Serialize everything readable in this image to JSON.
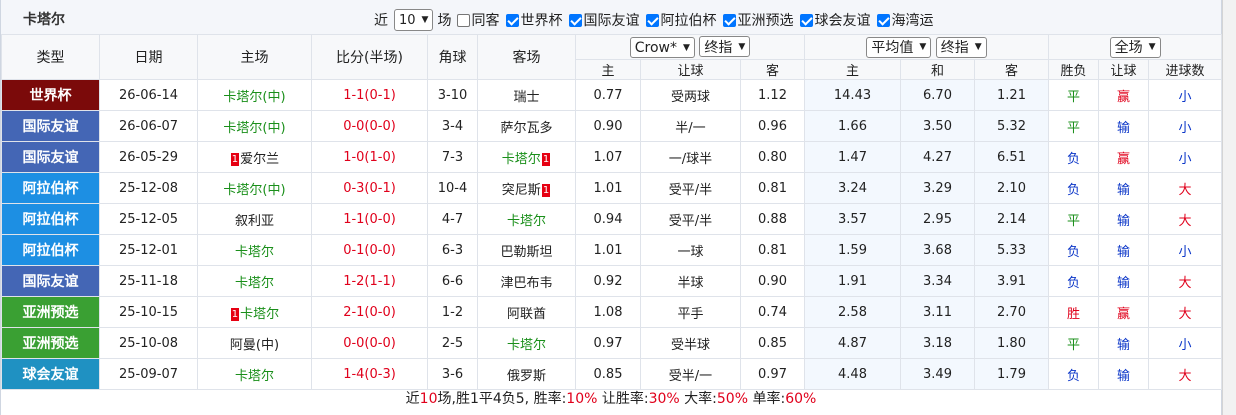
{
  "header": {
    "team": "卡塔尔",
    "near_label": "近",
    "count_value": "10",
    "games_label": "场",
    "filters": [
      {
        "label": "同客",
        "checked": false
      },
      {
        "label": "世界杯",
        "checked": true
      },
      {
        "label": "国际友谊",
        "checked": true
      },
      {
        "label": "阿拉伯杯",
        "checked": true
      },
      {
        "label": "亚洲预选",
        "checked": true
      },
      {
        "label": "球会友谊",
        "checked": true
      },
      {
        "label": "海湾运",
        "checked": true
      }
    ]
  },
  "columns": {
    "type": "类型",
    "date": "日期",
    "home": "主场",
    "score": "比分(半场)",
    "corner": "角球",
    "away": "客场",
    "company_select": "Crow*",
    "handicap_select": "终指",
    "odds_select": "平均值",
    "odds_select2": "终指",
    "result_select": "全场",
    "sub": {
      "h1": "主",
      "hcap": "让球",
      "a1": "客",
      "h2": "主",
      "draw": "和",
      "a2": "客",
      "wl": "胜负",
      "hcap_result": "让球",
      "goals": "进球数"
    }
  },
  "colors": {
    "世界杯": "#7b0a0a",
    "国际友谊": "#4466b5",
    "阿拉伯杯": "#1d8fe3",
    "亚洲预选": "#3aa033",
    "球会友谊": "#1f91c2",
    "win": "#e0001b",
    "draw": "#1a8f1a",
    "lose": "#0a35c8"
  },
  "rows": [
    {
      "league": "世界杯",
      "date": "26-06-14",
      "home": "卡塔尔(中)",
      "home_card": "",
      "home_card_after": "",
      "score": "1-1",
      "half": "(0-1)",
      "corner": "3-10",
      "away": "瑞士",
      "away_card": "",
      "o1": "0.77",
      "hcap": "受两球",
      "o2": "1.12",
      "avg_h": "14.43",
      "avg_d": "6.70",
      "avg_a": "1.21",
      "wl": "平",
      "hr": "赢",
      "goals": "小"
    },
    {
      "league": "国际友谊",
      "date": "26-06-07",
      "home": "卡塔尔(中)",
      "home_card": "",
      "home_card_after": "",
      "score": "0-0",
      "half": "(0-0)",
      "corner": "3-4",
      "away": "萨尔瓦多",
      "away_card": "",
      "o1": "0.90",
      "hcap": "半/一",
      "o2": "0.96",
      "avg_h": "1.66",
      "avg_d": "3.50",
      "avg_a": "5.32",
      "wl": "平",
      "hr": "输",
      "goals": "小"
    },
    {
      "league": "国际友谊",
      "date": "26-05-29",
      "home": "爱尔兰",
      "home_card": "1",
      "home_card_after": "",
      "score": "1-0",
      "half": "(1-0)",
      "corner": "7-3",
      "away": "卡塔尔",
      "away_card": "1",
      "o1": "1.07",
      "hcap": "一/球半",
      "o2": "0.80",
      "avg_h": "1.47",
      "avg_d": "4.27",
      "avg_a": "6.51",
      "wl": "负",
      "hr": "赢",
      "goals": "小"
    },
    {
      "league": "阿拉伯杯",
      "date": "25-12-08",
      "home": "卡塔尔(中)",
      "home_card": "",
      "home_card_after": "",
      "score": "0-3",
      "half": "(0-1)",
      "corner": "10-4",
      "away": "突尼斯",
      "away_card": "1",
      "o1": "1.01",
      "hcap": "受平/半",
      "o2": "0.81",
      "avg_h": "3.24",
      "avg_d": "3.29",
      "avg_a": "2.10",
      "wl": "负",
      "hr": "输",
      "goals": "大"
    },
    {
      "league": "阿拉伯杯",
      "date": "25-12-05",
      "home": "叙利亚",
      "home_card": "",
      "home_card_after": "",
      "score": "1-1",
      "half": "(0-0)",
      "corner": "4-7",
      "away": "卡塔尔",
      "away_card": "",
      "o1": "0.94",
      "hcap": "受平/半",
      "o2": "0.88",
      "avg_h": "3.57",
      "avg_d": "2.95",
      "avg_a": "2.14",
      "wl": "平",
      "hr": "输",
      "goals": "大"
    },
    {
      "league": "阿拉伯杯",
      "date": "25-12-01",
      "home": "卡塔尔",
      "home_card": "",
      "home_card_after": "",
      "score": "0-1",
      "half": "(0-0)",
      "corner": "6-3",
      "away": "巴勒斯坦",
      "away_card": "",
      "o1": "1.01",
      "hcap": "一球",
      "o2": "0.81",
      "avg_h": "1.59",
      "avg_d": "3.68",
      "avg_a": "5.33",
      "wl": "负",
      "hr": "输",
      "goals": "小"
    },
    {
      "league": "国际友谊",
      "date": "25-11-18",
      "home": "卡塔尔",
      "home_card": "",
      "home_card_after": "",
      "score": "1-2",
      "half": "(1-1)",
      "corner": "6-6",
      "away": "津巴布韦",
      "away_card": "",
      "o1": "0.92",
      "hcap": "半球",
      "o2": "0.90",
      "avg_h": "1.91",
      "avg_d": "3.34",
      "avg_a": "3.91",
      "wl": "负",
      "hr": "输",
      "goals": "大"
    },
    {
      "league": "亚洲预选",
      "date": "25-10-15",
      "home": "卡塔尔",
      "home_card": "1",
      "home_card_after": "",
      "score": "2-1",
      "half": "(0-0)",
      "corner": "1-2",
      "away": "阿联酋",
      "away_card": "",
      "o1": "1.08",
      "hcap": "平手",
      "o2": "0.74",
      "avg_h": "2.58",
      "avg_d": "3.11",
      "avg_a": "2.70",
      "wl": "胜",
      "hr": "赢",
      "goals": "大"
    },
    {
      "league": "亚洲预选",
      "date": "25-10-08",
      "home": "阿曼(中)",
      "home_card": "",
      "home_card_after": "",
      "score": "0-0",
      "half": "(0-0)",
      "corner": "2-5",
      "away": "卡塔尔",
      "away_card": "",
      "o1": "0.97",
      "hcap": "受半球",
      "o2": "0.85",
      "avg_h": "4.87",
      "avg_d": "3.18",
      "avg_a": "1.80",
      "wl": "平",
      "hr": "输",
      "goals": "小"
    },
    {
      "league": "球会友谊",
      "date": "25-09-07",
      "home": "卡塔尔",
      "home_card": "",
      "home_card_after": "",
      "score": "1-4",
      "half": "(0-3)",
      "corner": "3-6",
      "away": "俄罗斯",
      "away_card": "",
      "o1": "0.85",
      "hcap": "受半/一",
      "o2": "0.97",
      "avg_h": "4.48",
      "avg_d": "3.49",
      "avg_a": "1.79",
      "wl": "负",
      "hr": "输",
      "goals": "大"
    }
  ],
  "footer": {
    "near": "近",
    "count": "10",
    "summary": "场,胜1平4负5, 胜率:",
    "win_rate": "10%",
    "hcap_label": " 让胜率:",
    "hcap_rate": "30%",
    "big_label": " 大率:",
    "big_rate": "50%",
    "odd_label": " 单率:",
    "odd_rate": "60%"
  }
}
